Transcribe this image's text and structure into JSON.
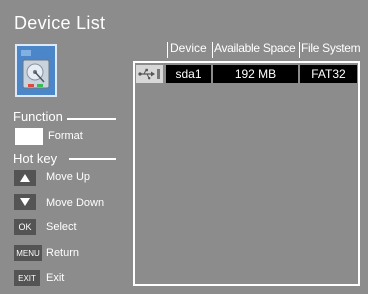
{
  "title": "Device List",
  "function": {
    "heading": "Function",
    "format_label": "Format"
  },
  "hotkey": {
    "heading": "Hot key",
    "items": [
      {
        "key": "up-arrow",
        "label": "Move Up"
      },
      {
        "key": "down-arrow",
        "label": "Move Down"
      },
      {
        "key": "OK",
        "label": "Select"
      },
      {
        "key": "MENU",
        "label": "Return"
      },
      {
        "key": "EXIT",
        "label": "Exit"
      }
    ]
  },
  "table": {
    "columns": [
      "Device",
      "Available Space",
      "File System"
    ],
    "rows": [
      {
        "icon": "usb-icon",
        "device": "sda1",
        "space": "192 MB",
        "fs": "FAT32"
      }
    ]
  },
  "colors": {
    "background": "#8c8c8c",
    "cell": "#000000",
    "key_bg": "#545454",
    "device_image": "#4a86c8"
  }
}
